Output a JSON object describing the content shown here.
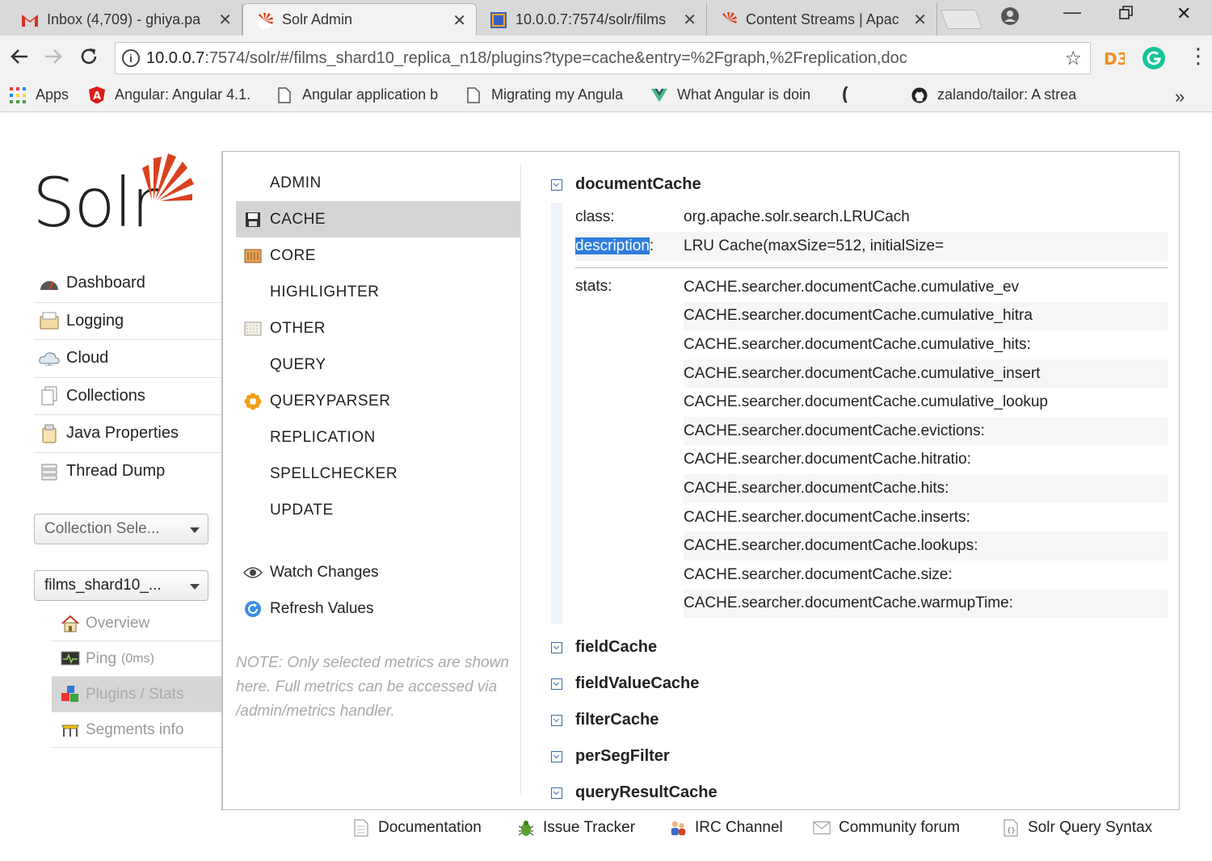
{
  "browser": {
    "tabs": [
      {
        "title": "Inbox (4,709) - ghiya.pa",
        "icon": "gmail-icon"
      },
      {
        "title": "Solr Admin",
        "icon": "solr-icon"
      },
      {
        "title": "10.0.0.7:7574/solr/films",
        "icon": "page-icon"
      },
      {
        "title": "Content Streams | Apac",
        "icon": "solr-icon"
      }
    ],
    "close_glyph": "✕",
    "url_prefix": "10.0.0.7",
    "url_rest": ":7574/solr/#/films_shard10_replica_n18/plugins?type=cache&entry=%2Fgraph,%2Freplication,doc",
    "bookmarks": [
      {
        "label": "Apps",
        "icon": "apps-grid-icon"
      },
      {
        "label": "Angular: Angular 4.1.",
        "icon": "angular-icon"
      },
      {
        "label": "Angular application b",
        "icon": "page-icon"
      },
      {
        "label": "Migrating my Angula",
        "icon": "page-icon"
      },
      {
        "label": "What Angular is doin",
        "icon": "vue-icon"
      },
      {
        "label": "",
        "icon": "bracket-icon"
      },
      {
        "label": "zalando/tailor: A strea",
        "icon": "github-icon"
      }
    ],
    "more_glyph": "»"
  },
  "solr": {
    "logo_text": "Solr",
    "main_nav": [
      {
        "label": "Dashboard",
        "icon": "dashboard-icon"
      },
      {
        "label": "Logging",
        "icon": "logging-icon"
      },
      {
        "label": "Cloud",
        "icon": "cloud-icon"
      },
      {
        "label": "Collections",
        "icon": "collections-icon"
      },
      {
        "label": "Java Properties",
        "icon": "java-properties-icon"
      },
      {
        "label": "Thread Dump",
        "icon": "thread-dump-icon"
      }
    ],
    "collection_selector": "Collection Sele...",
    "core_selector": "films_shard10_...",
    "core_nav": [
      {
        "label": "Overview",
        "icon": "home-icon",
        "extra": ""
      },
      {
        "label": "Ping",
        "icon": "ping-icon",
        "extra": "(0ms)"
      },
      {
        "label": "Plugins / Stats",
        "icon": "plugins-icon",
        "extra": ""
      },
      {
        "label": "Segments info",
        "icon": "segments-icon",
        "extra": ""
      }
    ],
    "categories": [
      {
        "label": "ADMIN",
        "icon": ""
      },
      {
        "label": "CACHE",
        "icon": "floppy-icon"
      },
      {
        "label": "CORE",
        "icon": "core-icon"
      },
      {
        "label": "HIGHLIGHTER",
        "icon": ""
      },
      {
        "label": "OTHER",
        "icon": "other-icon"
      },
      {
        "label": "QUERY",
        "icon": ""
      },
      {
        "label": "QUERYPARSER",
        "icon": "queryparser-icon"
      },
      {
        "label": "REPLICATION",
        "icon": ""
      },
      {
        "label": "SPELLCHECKER",
        "icon": ""
      },
      {
        "label": "UPDATE",
        "icon": ""
      }
    ],
    "actions": {
      "watch": "Watch Changes",
      "refresh": "Refresh Values"
    },
    "note": "NOTE: Only selected metrics are shown here. Full metrics can be accessed via /admin/metrics handler.",
    "plugins": {
      "expanded": {
        "name": "documentCache",
        "class_label": "class:",
        "class_value": "org.apache.solr.search.LRUCach",
        "description_label": "description",
        "description_colon": ":",
        "description_value": "LRU Cache(maxSize=512, initialSize=",
        "stats_label": "stats:",
        "stats": [
          "CACHE.searcher.documentCache.cumulative_ev",
          "CACHE.searcher.documentCache.cumulative_hitra",
          "CACHE.searcher.documentCache.cumulative_hits:",
          "CACHE.searcher.documentCache.cumulative_insert",
          "CACHE.searcher.documentCache.cumulative_lookup",
          "CACHE.searcher.documentCache.evictions:",
          "CACHE.searcher.documentCache.hitratio:",
          "CACHE.searcher.documentCache.hits:",
          "CACHE.searcher.documentCache.inserts:",
          "CACHE.searcher.documentCache.lookups:",
          "CACHE.searcher.documentCache.size:",
          "CACHE.searcher.documentCache.warmupTime:"
        ]
      },
      "collapsed": [
        "fieldCache",
        "fieldValueCache",
        "filterCache",
        "perSegFilter",
        "queryResultCache"
      ]
    },
    "footer": [
      {
        "label": "Documentation",
        "icon": "documentation-icon"
      },
      {
        "label": "Issue Tracker",
        "icon": "bug-icon"
      },
      {
        "label": "IRC Channel",
        "icon": "irc-icon"
      },
      {
        "label": "Community forum",
        "icon": "mail-icon"
      },
      {
        "label": "Solr Query Syntax",
        "icon": "query-syntax-icon"
      }
    ]
  },
  "colors": {
    "selection": "#2f7ddd",
    "solr_red": "#d9411e",
    "toggle_blue": "#3b6aa8"
  }
}
